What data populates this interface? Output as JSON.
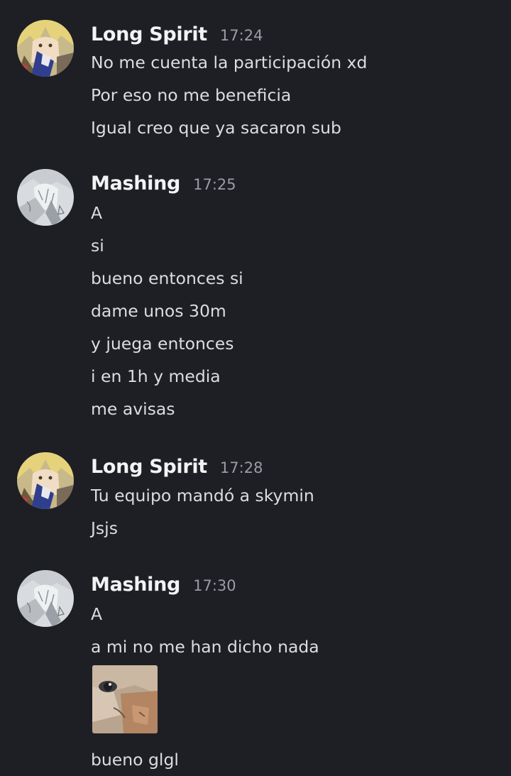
{
  "groups": [
    {
      "author": "Long Spirit",
      "time": "17:24",
      "avatar_icon": "anime-blonde-avatar",
      "messages": [
        "No me cuenta la participación xd",
        "Por eso no me beneficia",
        "Igual creo que ya sacaron sub"
      ]
    },
    {
      "author": "Mashing",
      "time": "17:25",
      "avatar_icon": "sketch-avatar",
      "messages": [
        "A",
        "si",
        "bueno entonces si",
        "dame unos 30m",
        "y juega entonces",
        "i en 1h y media",
        "me avisas"
      ]
    },
    {
      "author": "Long Spirit",
      "time": "17:28",
      "avatar_icon": "anime-blonde-avatar",
      "messages": [
        "Tu equipo mandó a skymin",
        "Jsjs"
      ]
    },
    {
      "author": "Mashing",
      "time": "17:30",
      "avatar_icon": "sketch-avatar",
      "messages": [
        "A",
        "a mi no me han dicho nada",
        "bueno glgl"
      ],
      "attachment_icon": "cat-photo-attachment"
    }
  ],
  "colors": {
    "background": "#1e1f24",
    "author_name": "#f2f3f5",
    "timestamp": "#9a9ca4",
    "message_text": "#dbdde1"
  }
}
